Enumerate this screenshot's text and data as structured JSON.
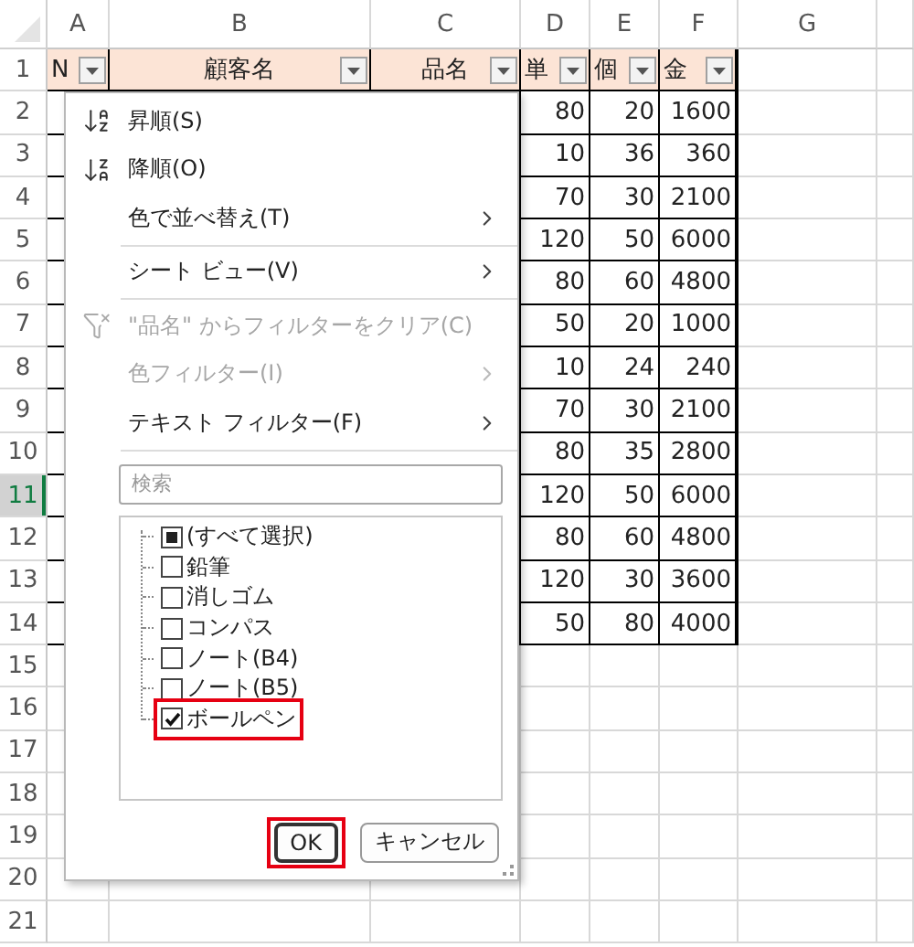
{
  "column_headers": [
    {
      "label": "A"
    },
    {
      "label": "B"
    },
    {
      "label": "C"
    },
    {
      "label": "D"
    },
    {
      "label": "E"
    },
    {
      "label": "F"
    },
    {
      "label": "G"
    }
  ],
  "row_headers": [
    {
      "label": "1",
      "selected": false
    },
    {
      "label": "2",
      "selected": false
    },
    {
      "label": "3",
      "selected": false
    },
    {
      "label": "4",
      "selected": false
    },
    {
      "label": "5",
      "selected": false
    },
    {
      "label": "6",
      "selected": false
    },
    {
      "label": "7",
      "selected": false
    },
    {
      "label": "8",
      "selected": false
    },
    {
      "label": "9",
      "selected": false
    },
    {
      "label": "10",
      "selected": false
    },
    {
      "label": "11",
      "selected": true
    },
    {
      "label": "12",
      "selected": false
    },
    {
      "label": "13",
      "selected": false
    },
    {
      "label": "14",
      "selected": false
    },
    {
      "label": "15",
      "selected": false
    },
    {
      "label": "16",
      "selected": false
    },
    {
      "label": "17",
      "selected": false
    },
    {
      "label": "18",
      "selected": false
    },
    {
      "label": "19",
      "selected": false
    },
    {
      "label": "20",
      "selected": false
    },
    {
      "label": "21",
      "selected": false
    }
  ],
  "table": {
    "header": [
      {
        "text": "N",
        "filter": true
      },
      {
        "text": "顧客名",
        "filter": true
      },
      {
        "text": "品名",
        "filter": true
      },
      {
        "text": "単",
        "filter": true
      },
      {
        "text": "個",
        "filter": true
      },
      {
        "text": "金",
        "filter": true
      }
    ],
    "rows": [
      {
        "values": [
          "80",
          "20",
          "1600"
        ]
      },
      {
        "values": [
          "10",
          "36",
          "360"
        ]
      },
      {
        "values": [
          "70",
          "30",
          "2100"
        ]
      },
      {
        "values": [
          "120",
          "50",
          "6000"
        ]
      },
      {
        "values": [
          "80",
          "60",
          "4800"
        ]
      },
      {
        "values": [
          "50",
          "20",
          "1000"
        ]
      },
      {
        "values": [
          "10",
          "24",
          "240"
        ]
      },
      {
        "values": [
          "70",
          "30",
          "2100"
        ]
      },
      {
        "values": [
          "80",
          "35",
          "2800"
        ]
      },
      {
        "values": [
          "120",
          "50",
          "6000"
        ]
      },
      {
        "values": [
          "80",
          "60",
          "4800"
        ]
      },
      {
        "values": [
          "120",
          "30",
          "3600"
        ]
      },
      {
        "values": [
          "50",
          "80",
          "4000"
        ]
      }
    ]
  },
  "filter_menu": {
    "items": [
      {
        "kind": "ascending",
        "label": "昇順(S)",
        "disabled": false,
        "submenu": false
      },
      {
        "kind": "descending",
        "label": "降順(O)",
        "disabled": false,
        "submenu": false
      },
      {
        "kind": "plain",
        "label": "色で並べ替え(T)",
        "disabled": false,
        "submenu": true
      },
      {
        "kind": "divider"
      },
      {
        "kind": "plain",
        "label": "シート ビュー(V)",
        "disabled": false,
        "submenu": true
      },
      {
        "kind": "divider"
      },
      {
        "kind": "unfilter",
        "label": "\"品名\" からフィルターをクリア(C)",
        "disabled": true,
        "submenu": false
      },
      {
        "kind": "plain",
        "label": "色フィルター(I)",
        "disabled": true,
        "submenu": true
      },
      {
        "kind": "plain",
        "label": "テキスト フィルター(F)",
        "disabled": false,
        "submenu": true
      },
      {
        "kind": "divider"
      }
    ],
    "search": {
      "placeholder": "検索"
    },
    "values": [
      {
        "label": "(すべて選択)",
        "checked": false,
        "partial": true,
        "highlighted": false
      },
      {
        "label": "鉛筆",
        "checked": false,
        "partial": false,
        "highlighted": false
      },
      {
        "label": "消しゴム",
        "checked": false,
        "partial": false,
        "highlighted": false
      },
      {
        "label": "コンパス",
        "checked": false,
        "partial": false,
        "highlighted": false
      },
      {
        "label": "ノート(B4)",
        "checked": false,
        "partial": false,
        "highlighted": false
      },
      {
        "label": "ノート(B5)",
        "checked": false,
        "partial": false,
        "highlighted": false
      },
      {
        "label": "ボールペン",
        "checked": true,
        "partial": false,
        "highlighted": true
      }
    ],
    "buttons": [
      {
        "label": "OK",
        "default": true,
        "highlighted": true
      },
      {
        "label": "キャンセル",
        "default": false,
        "highlighted": false
      }
    ]
  }
}
